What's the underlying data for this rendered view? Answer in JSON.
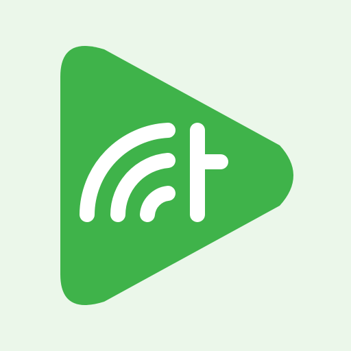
{
  "app_icon": {
    "icon_name": "podcast-play-logo-icon",
    "colors": {
      "background": "#ebf7ea",
      "play_triangle": "#3fb34a",
      "glyph": "#ffffff"
    }
  }
}
